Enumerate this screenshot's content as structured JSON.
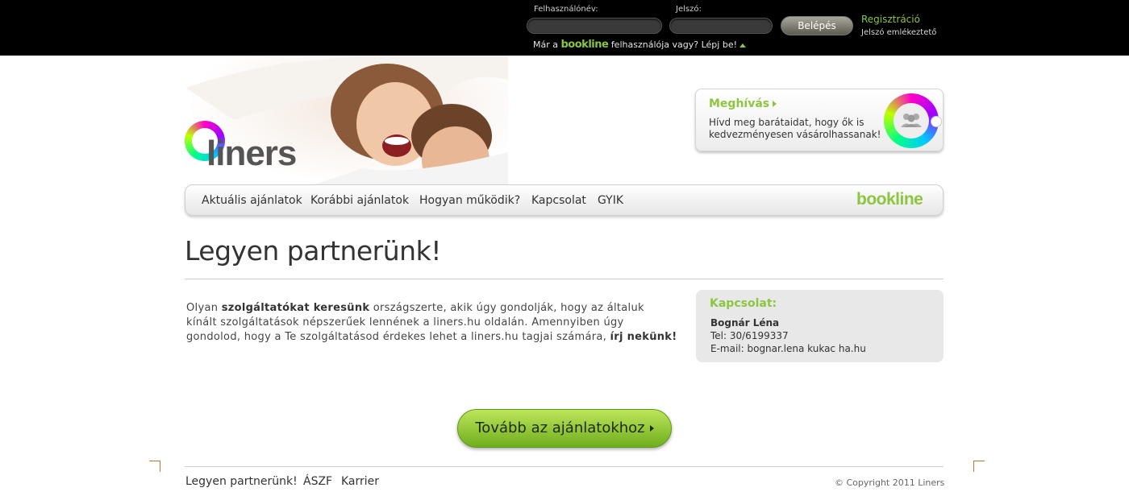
{
  "topbar": {
    "username_label": "Felhasználónév:",
    "username_value": "",
    "password_label": "Jelszó:",
    "password_value": "",
    "login_button": "Belépés",
    "register_link": "Regisztráció",
    "forgot_link": "Jelszó emlékeztető",
    "already_prefix": "Már a",
    "already_brand": "bookline",
    "already_suffix": "felhasználója vagy? Lépj be!"
  },
  "logo": {
    "text": "liners"
  },
  "invite": {
    "title": "Meghívás",
    "text": "Hívd meg barátaidat, hogy ők is kedvezményesen vásárolhassanak!"
  },
  "nav": {
    "items": [
      {
        "label": "Aktuális ajánlatok"
      },
      {
        "label": "Korábbi ajánlatok"
      },
      {
        "label": "Hogyan működik?"
      },
      {
        "label": "Kapcsolat"
      },
      {
        "label": "GYIK"
      }
    ],
    "partner_logo": "bookline"
  },
  "main": {
    "title": "Legyen partnerünk!",
    "text_1": "Olyan ",
    "text_bold_1": "szolgáltatókat keresünk",
    "text_2": " országszerte, akik úgy gondolják, hogy az általuk kínált szolgáltatások népszerűek lennének a liners.hu oldalán. Amennyiben úgy gondolod, hogy a Te szolgáltatásod érdekes lehet a liners.hu tagjai számára, ",
    "text_bold_2": "írj nekünk!"
  },
  "contact": {
    "title": "Kapcsolat:",
    "name": "Bognár Léna",
    "phone": "Tel: 30/6199337",
    "email": "E-mail: bognar.lena kukac ha.hu"
  },
  "cta": {
    "label": "Tovább az ajánlatokhoz"
  },
  "footer": {
    "links": [
      {
        "label": "Legyen partnerünk!"
      },
      {
        "label": "ÁSZF"
      },
      {
        "label": "Karrier"
      }
    ],
    "copyright": "© Copyright 2011 Liners"
  },
  "colors": {
    "brand_green": "#8cc63f",
    "topbar_bg": "#000000",
    "cta_green": "#7ab828"
  }
}
